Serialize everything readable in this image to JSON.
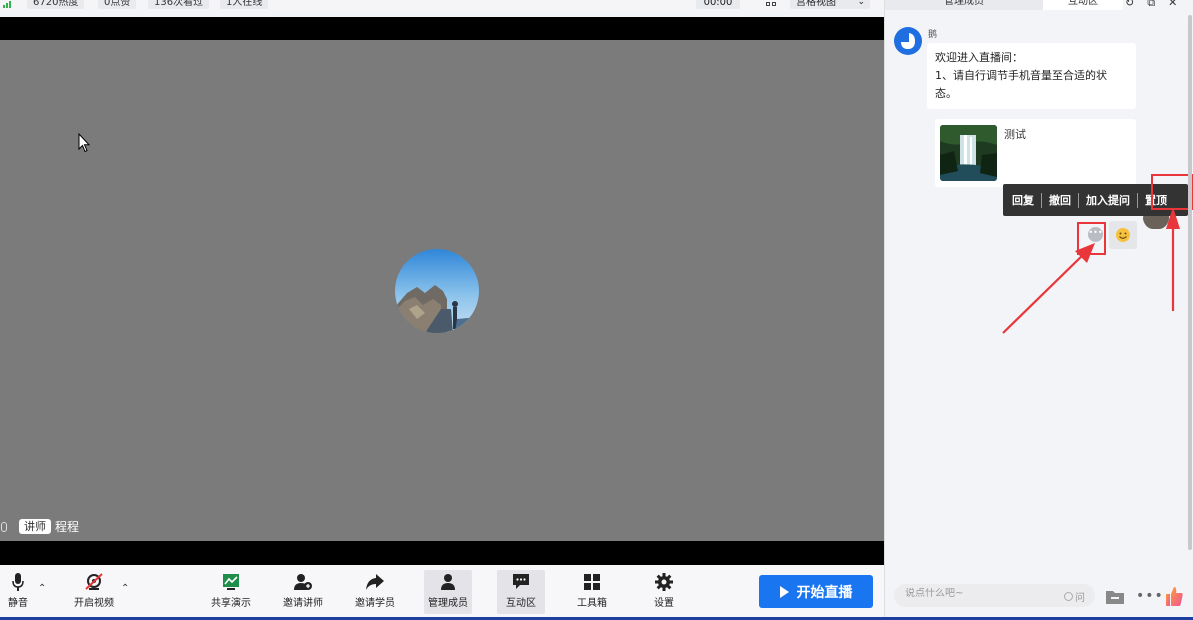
{
  "stats": {
    "heat": "6720热度",
    "likes": "0点赞",
    "views": "136次看过",
    "online": "1人在线",
    "timer": "00:00",
    "view_mode": "宫格视图"
  },
  "video": {
    "speaker_role": "讲师",
    "speaker_name": "程程"
  },
  "toolbar": {
    "mute": "静音",
    "camera": "开启视频",
    "share": "共享演示",
    "invite_lecturer": "邀请讲师",
    "invite_student": "邀请学员",
    "manage_members": "管理成员",
    "interaction": "互动区",
    "toolbox": "工具箱",
    "settings": "设置",
    "start_live": "开始直播"
  },
  "panel": {
    "tab_manage": "管理成员",
    "tab_interact": "互动区",
    "message": {
      "author": "鹅",
      "text": "欢迎进入直播间：\n1、请自行调节手机音量至合适的状态。",
      "card_title": "测试"
    },
    "context_menu": [
      "回复",
      "撤回",
      "加入提问",
      "置顶"
    ],
    "input_placeholder": "说点什么吧~",
    "question_toggle": "问"
  },
  "colors": {
    "accent": "#1976f0",
    "highlight": "#e8363b",
    "video_bg": "#7b7b7b"
  }
}
